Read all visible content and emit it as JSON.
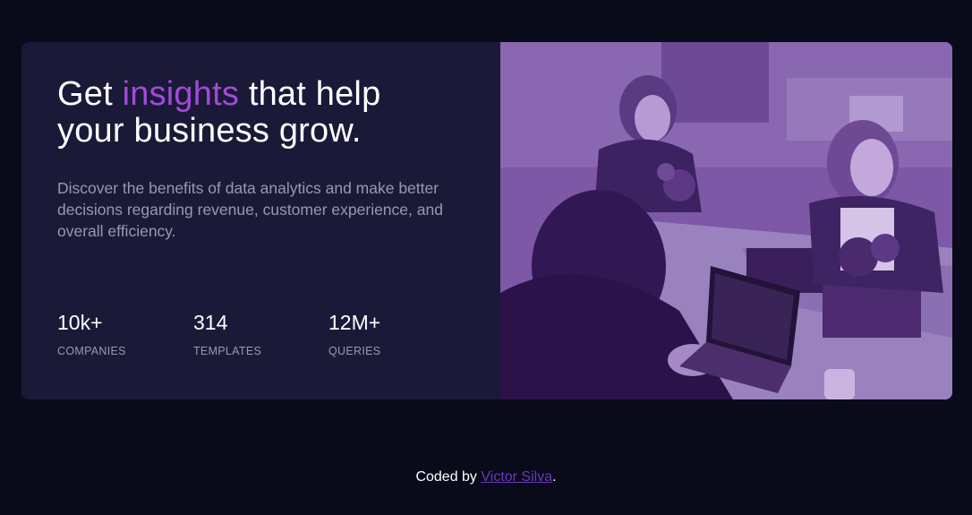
{
  "hero": {
    "headline_before": "Get ",
    "headline_accent": "insights",
    "headline_after_line1": " that help",
    "headline_line2": "your business grow.",
    "description": "Discover the benefits of data analytics and make better decisions regarding revenue, customer experience, and overall efficiency.",
    "accent_color": "#a24ad9"
  },
  "stats": [
    {
      "value": "10k+",
      "label": "COMPANIES"
    },
    {
      "value": "314",
      "label": "TEMPLATES"
    },
    {
      "value": "12M+",
      "label": "QUERIES"
    }
  ],
  "image": {
    "icon": "office-team-photo",
    "tint_color": "#7b55a4"
  },
  "footer": {
    "prefix": "Coded by ",
    "author": "Victor Silva",
    "suffix": "."
  }
}
